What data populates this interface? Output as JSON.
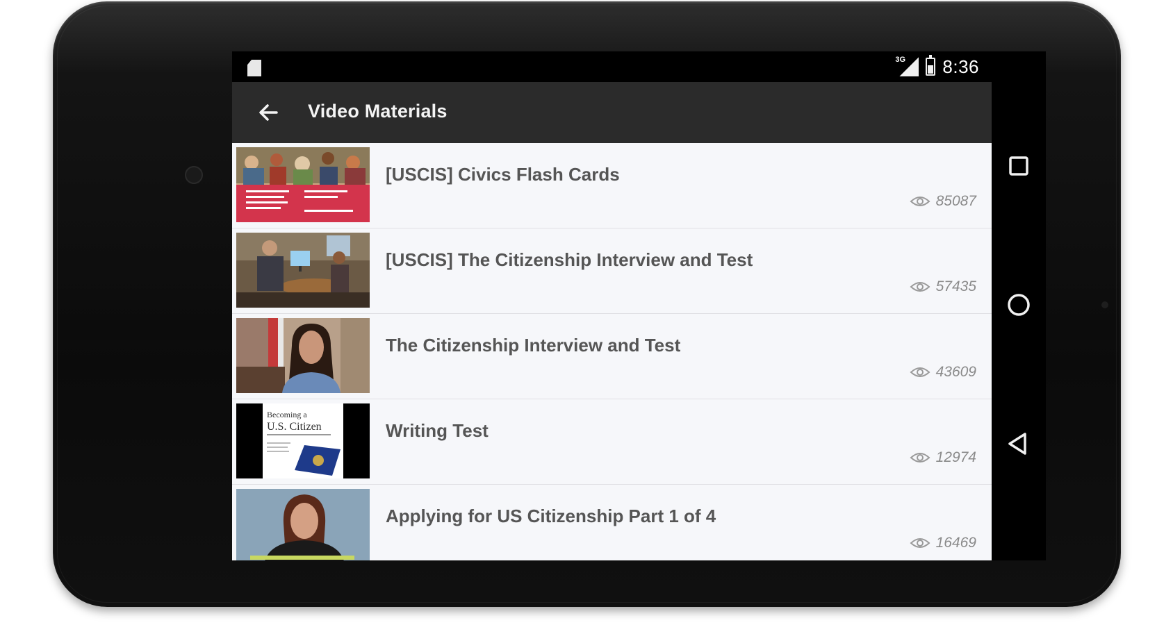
{
  "status_bar": {
    "network_label": "3G",
    "time": "8:36"
  },
  "app_bar": {
    "title": "Video Materials"
  },
  "videos": [
    {
      "title": "[USCIS] Civics Flash Cards",
      "views": "85087",
      "thumb": "civics-flash-cards-thumbnail"
    },
    {
      "title": "[USCIS] The Citizenship Interview and Test",
      "views": "57435",
      "thumb": "office-interview-thumbnail"
    },
    {
      "title": "The Citizenship Interview and Test",
      "views": "43609",
      "thumb": "woman-speaker-thumbnail"
    },
    {
      "title": "Writing Test",
      "views": "12974",
      "thumb": "becoming-us-citizen-thumbnail"
    },
    {
      "title": "Applying for US Citizenship Part 1 of 4",
      "views": "16469",
      "thumb": "woman-presenter-thumbnail"
    }
  ],
  "thumbnail_text": {
    "becoming_line1": "Becoming a",
    "becoming_line2": "U.S. Citizen"
  },
  "colors": {
    "app_bar": "#2b2b2b",
    "list_background": "#f6f7fa",
    "title_text": "#555555",
    "view_count": "#8a8a8a",
    "flash_card_red": "#d3344c"
  },
  "nav_buttons": [
    "recents-icon",
    "home-icon",
    "back-icon"
  ]
}
